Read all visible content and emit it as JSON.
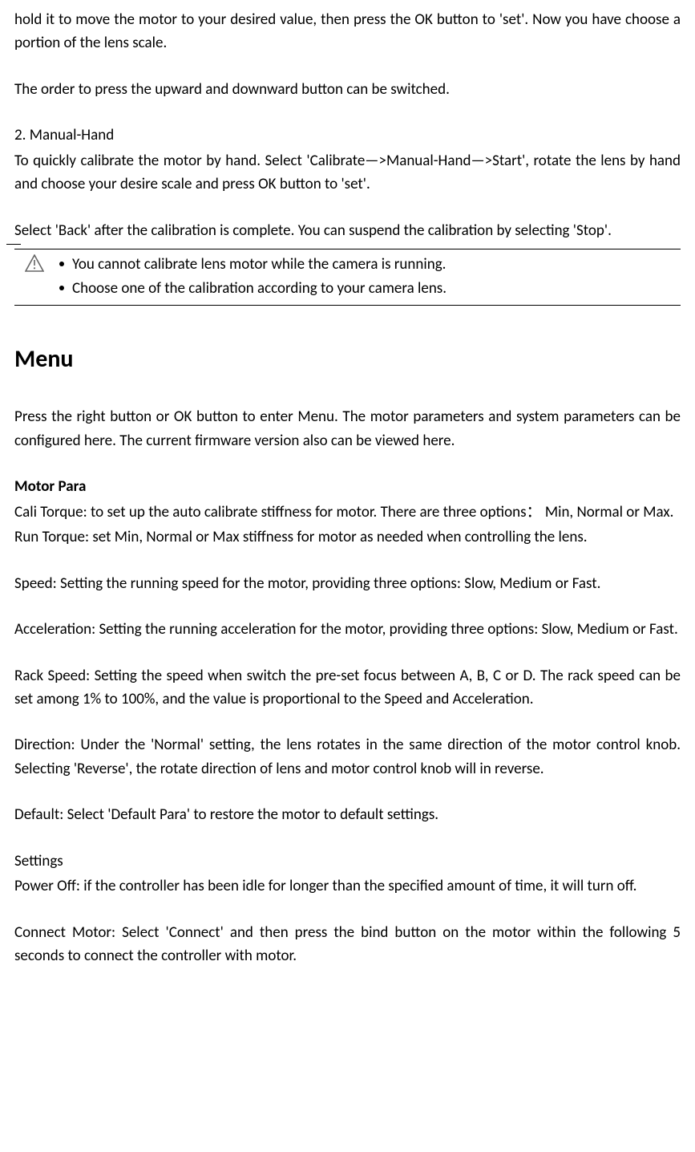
{
  "intro": {
    "p1": "hold it to move the motor to your desired value, then press the OK button to 'set'. Now you have choose a portion of the lens scale.",
    "p2": "The order to press the upward and downward button can be switched.",
    "p3_title": "2. Manual-Hand",
    "p3": "To quickly calibrate the motor by hand. Select 'Calibrate—>Manual-Hand—>Start', rotate the lens by hand and choose your desire scale and press OK button to 'set'.",
    "p4": "Select 'Back' after the calibration is complete. You can suspend the calibration by selecting 'Stop'."
  },
  "warnings": {
    "item1": "You cannot calibrate lens motor while the camera is running.",
    "item2": "Choose one of the calibration according to your camera lens."
  },
  "menu": {
    "heading": "Menu",
    "intro": "Press the right button or OK button to enter Menu. The motor parameters and system parameters can be configured here. The current firmware version also can be viewed here.",
    "motor_para_heading": "Motor Para",
    "cali_torque": "Cali Torque: to set up the auto calibrate stiffness for motor. There are three options： Min, Normal or Max.",
    "run_torque": "Run Torque: set Min, Normal or Max stiffness for motor as needed when controlling the lens.",
    "speed": "Speed: Setting the running speed for the motor, providing three options: Slow, Medium or Fast.",
    "acceleration": "Acceleration: Setting the running acceleration for the motor, providing three options: Slow, Medium or Fast.",
    "rack_speed": "Rack Speed: Setting the speed when switch the pre-set focus between A, B, C or D. The rack speed can be set among 1% to 100%, and the value is proportional to the Speed and Acceleration.",
    "direction": "Direction: Under the 'Normal' setting, the lens rotates in the same direction of the motor control knob. Selecting 'Reverse', the rotate direction of lens and motor control knob will in reverse.",
    "default": "Default: Select 'Default Para' to restore the motor to default settings.",
    "settings_heading": "Settings",
    "power_off": "Power Off: if the controller has been idle for longer than the specified amount of time, it will turn off.",
    "connect_motor": "Connect Motor: Select 'Connect' and then press the bind button on the motor within the following 5 seconds to connect the controller with motor."
  }
}
